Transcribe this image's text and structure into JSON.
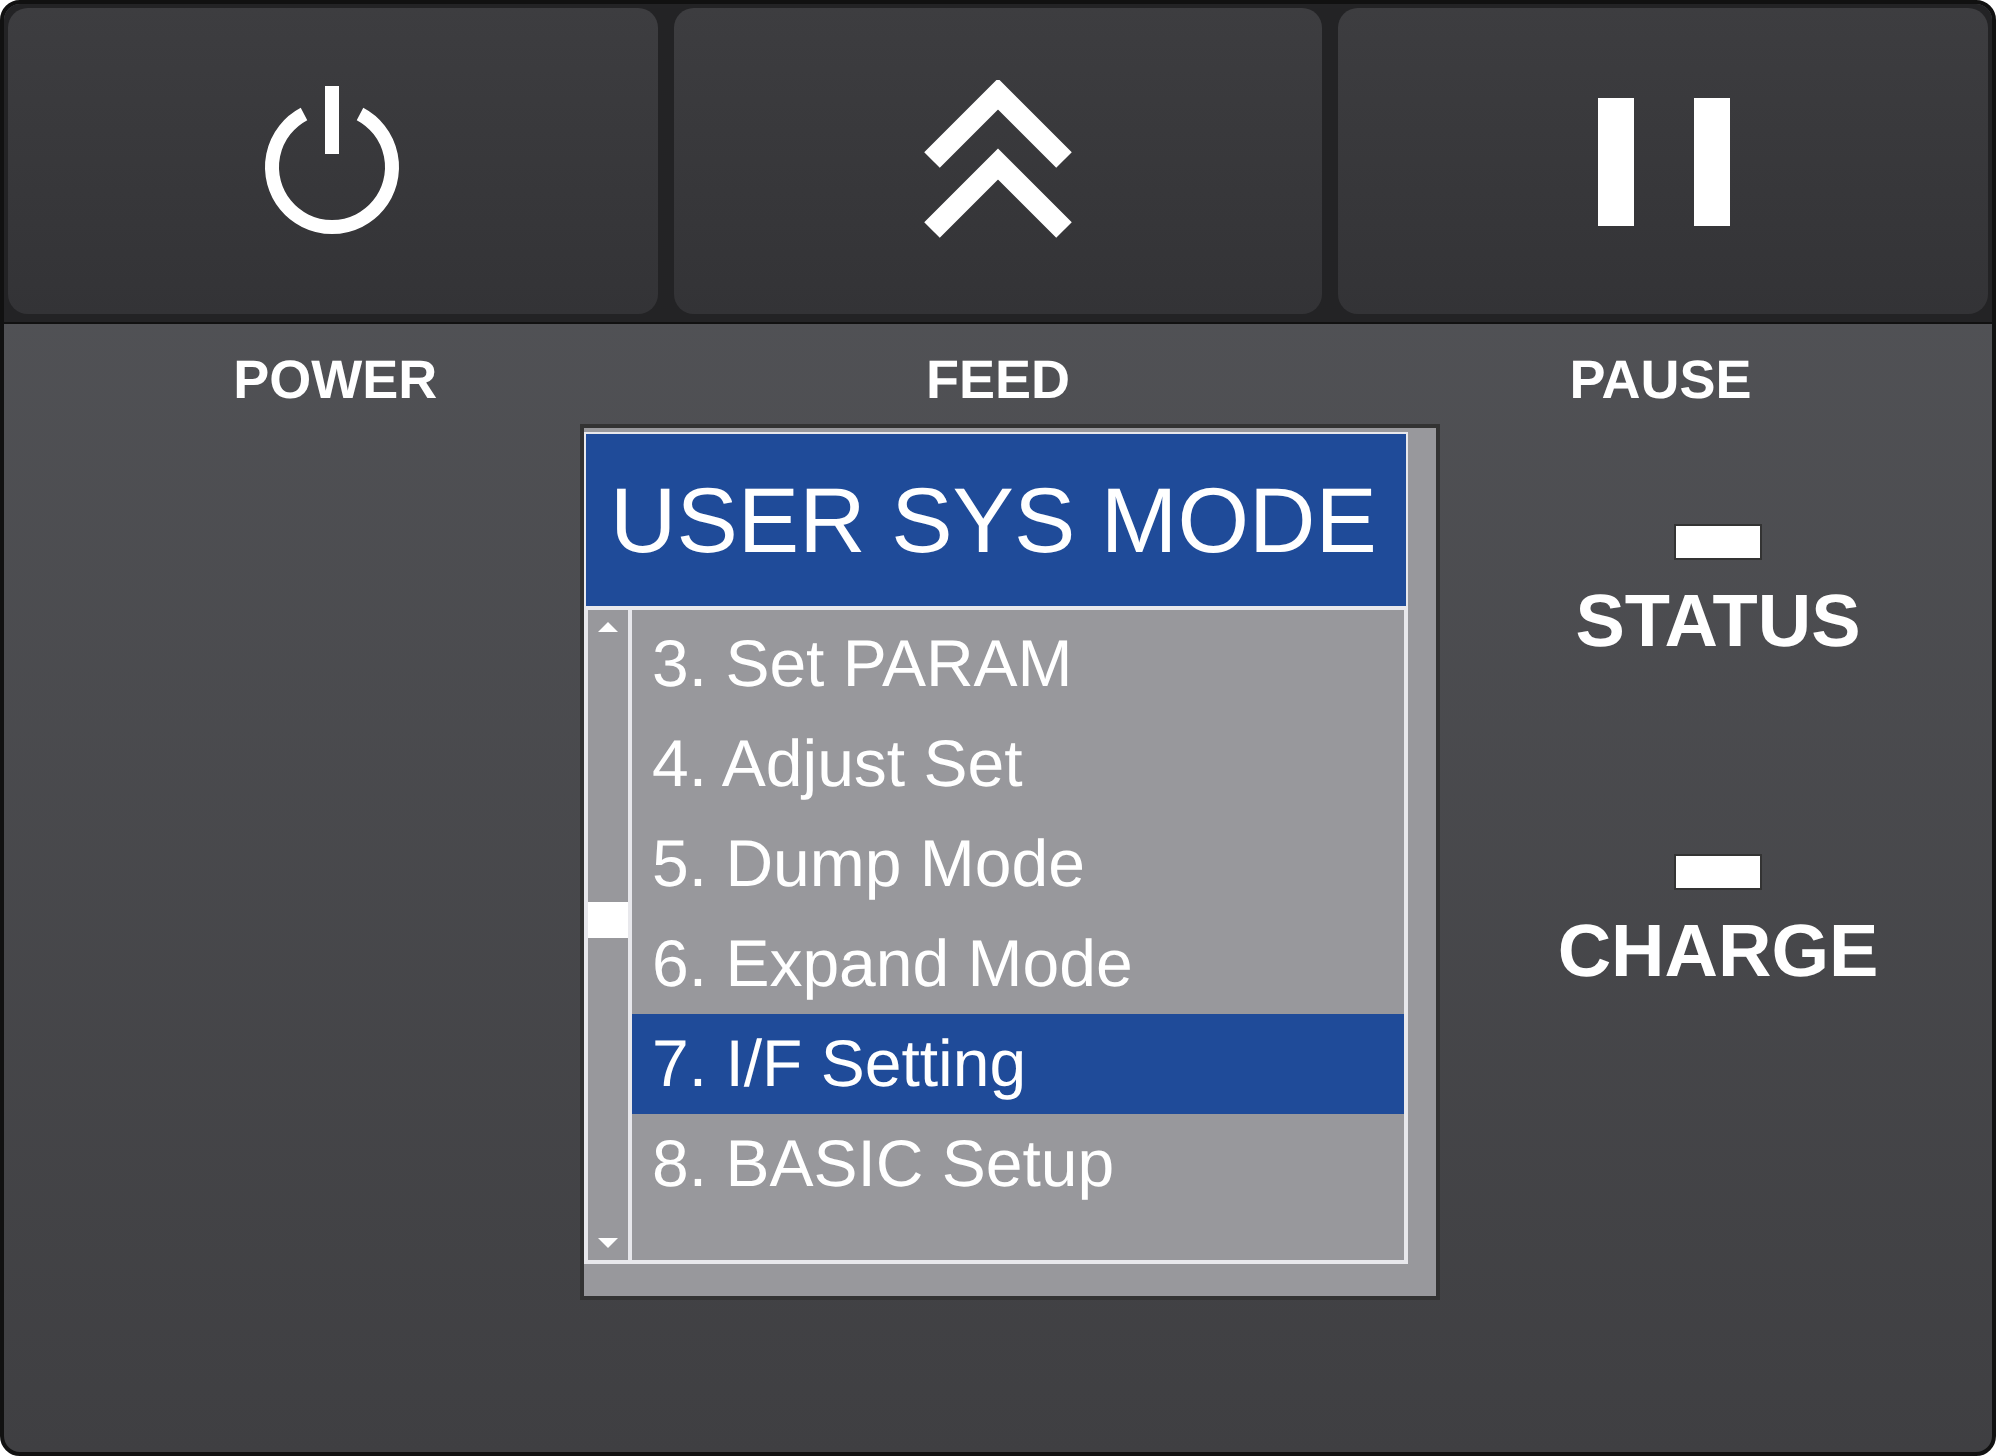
{
  "buttons": [
    {
      "kind": "power",
      "label": "POWER"
    },
    {
      "kind": "feed",
      "label": "FEED"
    },
    {
      "kind": "pause",
      "label": "PAUSE"
    }
  ],
  "lcd": {
    "title": "USER SYS MODE",
    "items": [
      {
        "label": "3. Set PARAM",
        "selected": false
      },
      {
        "label": "4. Adjust Set",
        "selected": false
      },
      {
        "label": "5. Dump Mode",
        "selected": false
      },
      {
        "label": "6. Expand Mode",
        "selected": false
      },
      {
        "label": "7. I/F Setting",
        "selected": true
      },
      {
        "label": "8. BASIC Setup",
        "selected": false
      }
    ]
  },
  "indicators": [
    {
      "label": "STATUS"
    },
    {
      "label": "CHARGE"
    }
  ]
}
